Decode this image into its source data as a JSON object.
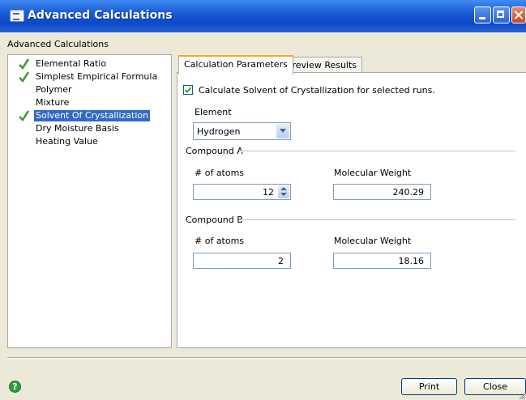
{
  "window": {
    "title": "Advanced Calculations"
  },
  "header": {
    "label": "Advanced Calculations"
  },
  "tree": {
    "items": [
      {
        "label": "Elemental Ratio",
        "checked": true,
        "selected": false
      },
      {
        "label": "Simplest Empirical Formula",
        "checked": true,
        "selected": false
      },
      {
        "label": "Polymer",
        "checked": false,
        "selected": false
      },
      {
        "label": "Mixture",
        "checked": false,
        "selected": false
      },
      {
        "label": "Solvent Of Crystallization",
        "checked": true,
        "selected": true
      },
      {
        "label": "Dry Moisture Basis",
        "checked": false,
        "selected": false
      },
      {
        "label": "Heating Value",
        "checked": false,
        "selected": false
      }
    ]
  },
  "tabs": [
    {
      "label": "Calculation Parameters",
      "active": true
    },
    {
      "label": "Preview Results",
      "active": false
    }
  ],
  "params": {
    "checkbox_label": "Calculate Solvent of Crystallization for selected runs.",
    "checkbox_checked": true,
    "element_label": "Element",
    "element_value": "Hydrogen",
    "compound_a": {
      "title": "Compound A",
      "atoms_label": "# of atoms",
      "atoms_value": "12",
      "mw_label": "Molecular Weight",
      "mw_value": "240.29"
    },
    "compound_b": {
      "title": "Compound B",
      "atoms_label": "# of atoms",
      "atoms_value": "2",
      "mw_label": "Molecular Weight",
      "mw_value": "18.16"
    }
  },
  "footer": {
    "help_symbol": "?",
    "print_label": "Print",
    "close_label": "Close"
  },
  "colors": {
    "title_bar": "#0a49c9",
    "selection": "#316ac5",
    "check_green": "#3a9a2a",
    "tab_accent": "#f0a81c"
  }
}
